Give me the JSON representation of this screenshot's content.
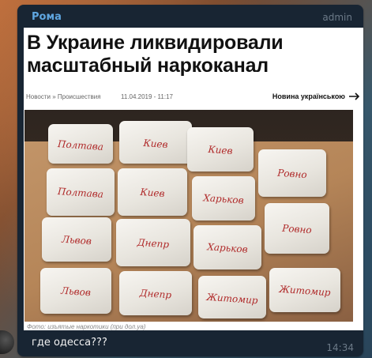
{
  "message": {
    "sender": "Рома",
    "role": "admin",
    "text": "где одесса???",
    "time": "14:34"
  },
  "article": {
    "headline": "В Украине ликвидировали масштабный наркоканал",
    "breadcrumbs": "Новости » Происшествия",
    "date": "11.04.2019 - 11:17",
    "lang_link": "Новина українською",
    "caption": "Фото: изъятые наркотики (при дол.уа)"
  },
  "photo": {
    "bags": [
      {
        "label": "Полтава"
      },
      {
        "label": "Киев"
      },
      {
        "label": "Киев"
      },
      {
        "label": "Ровно"
      },
      {
        "label": "Полтава"
      },
      {
        "label": "Киев"
      },
      {
        "label": "Харьков"
      },
      {
        "label": "Ровно"
      },
      {
        "label": "Львов"
      },
      {
        "label": "Днепр"
      },
      {
        "label": "Харьков"
      },
      {
        "label": "Львов"
      },
      {
        "label": "Днепр"
      },
      {
        "label": "Житомир"
      },
      {
        "label": "Житомир"
      }
    ]
  },
  "colors": {
    "sender": "#5fa6e0",
    "bubble": "#182533",
    "label_ink": "#b02a2a"
  },
  "icons": [
    "arrow-right-icon",
    "avatar"
  ]
}
